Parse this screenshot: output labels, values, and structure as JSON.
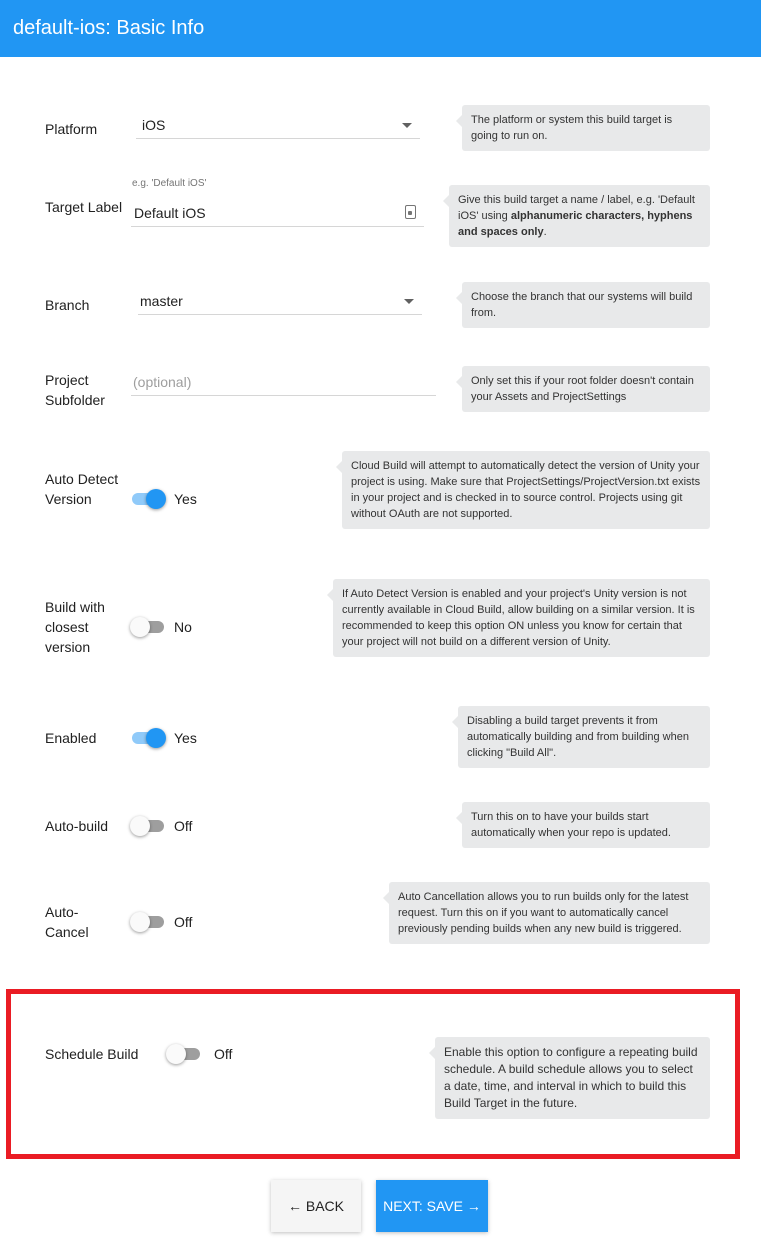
{
  "header": {
    "title": "default-ios: Basic Info"
  },
  "platform": {
    "label": "Platform",
    "value": "iOS",
    "tip": "The platform or system this build target is going to run on."
  },
  "target_label": {
    "label": "Target Label",
    "hint": "e.g. 'Default iOS'",
    "value": "Default iOS",
    "tip_prefix": "Give this build target a name / label, e.g. 'Default iOS' using ",
    "tip_bold": "alphanumeric characters, hyphens and spaces only",
    "tip_suffix": "."
  },
  "branch": {
    "label": "Branch",
    "value": "master",
    "tip": "Choose the branch that our systems will build from."
  },
  "subfolder": {
    "label": "Project Subfolder",
    "placeholder": "(optional)",
    "tip": "Only set this if your root folder doesn't contain your Assets and ProjectSettings"
  },
  "auto_detect": {
    "label": "Auto Detect Version",
    "state": "Yes",
    "tip": "Cloud Build will attempt to automatically detect the version of Unity your project is using. Make sure that ProjectSettings/ProjectVersion.txt exists in your project and is checked in to source control. Projects using git without OAuth are not supported."
  },
  "closest_version": {
    "label": "Build with closest version",
    "state": "No",
    "tip": "If Auto Detect Version is enabled and your project's Unity version is not currently available in Cloud Build, allow building on a similar version. It is recommended to keep this option ON unless you know for certain that your project will not build on a different version of Unity."
  },
  "enabled": {
    "label": "Enabled",
    "state": "Yes",
    "tip": "Disabling a build target prevents it from automatically building and from building when clicking \"Build All\"."
  },
  "auto_build": {
    "label": "Auto-build",
    "state": "Off",
    "tip": "Turn this on to have your builds start automatically when your repo is updated."
  },
  "auto_cancel": {
    "label": "Auto-Cancel",
    "state": "Off",
    "tip": "Auto Cancellation allows you to run builds only for the latest request. Turn this on if you want to automatically cancel previously pending builds when any new build is triggered."
  },
  "schedule_build": {
    "label": "Schedule Build",
    "state": "Off",
    "tip": "Enable this option to configure a repeating build schedule. A build schedule allows you to select a date, time, and interval in which to build this Build Target in the future."
  },
  "buttons": {
    "back": "← BACK",
    "next": "NEXT: SAVE →"
  },
  "colors": {
    "primary": "#2196f3",
    "highlight": "#ea1c24",
    "tip_bg": "#e8e9ea"
  }
}
